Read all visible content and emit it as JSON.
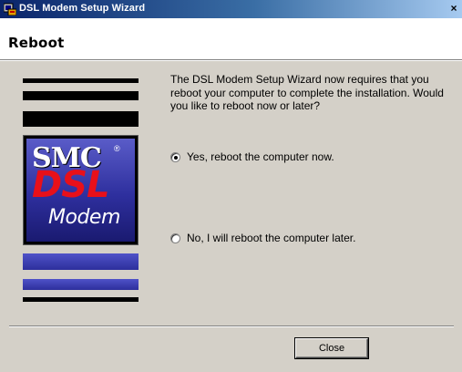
{
  "window": {
    "title": "DSL Modem Setup Wizard",
    "close_glyph": "×",
    "icon": "wizard-app-icon"
  },
  "header": {
    "title": "Reboot"
  },
  "logo": {
    "brand": "SMC",
    "registered": "®",
    "product_line1": "DSL",
    "product_line2": "Modem",
    "colors": {
      "dsl_red": "#e8101a",
      "panel_blue": "#2e2f9e"
    }
  },
  "content": {
    "message": "The DSL Modem Setup Wizard now requires that you reboot your computer to complete the installation.  Would you like to reboot now or later?",
    "options": [
      {
        "label": "Yes, reboot the computer now.",
        "checked": true
      },
      {
        "label": "No, I will reboot the computer later.",
        "checked": false
      }
    ]
  },
  "footer": {
    "close_label": "Close"
  }
}
